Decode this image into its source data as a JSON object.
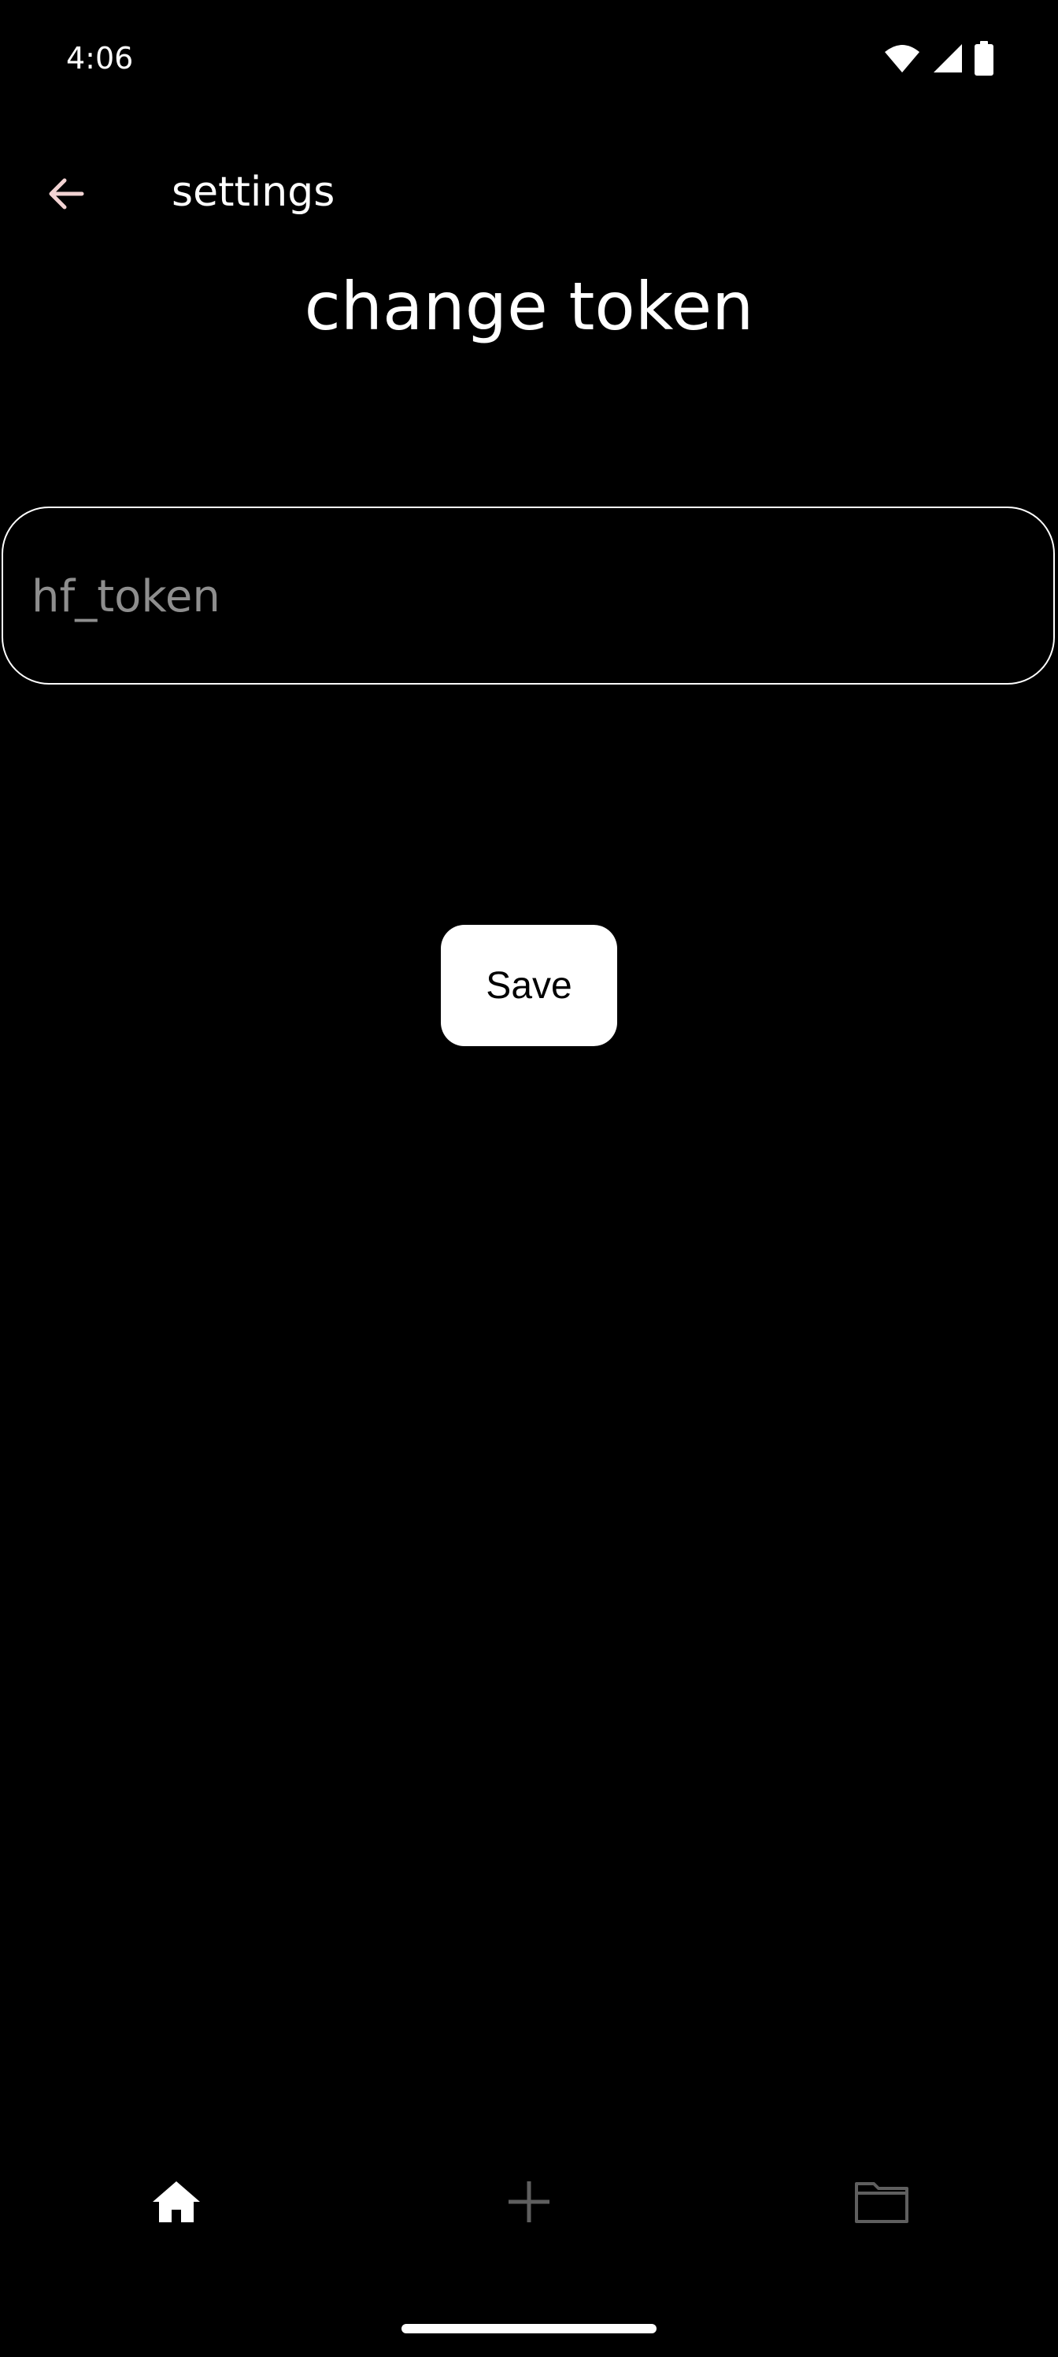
{
  "status_bar": {
    "time": "4:06",
    "icons": [
      "wifi-icon",
      "cellular-signal-icon",
      "battery-icon"
    ]
  },
  "app_bar": {
    "back_icon": "arrow-back-icon",
    "title": "settings"
  },
  "page": {
    "title": "change token"
  },
  "token_input": {
    "placeholder": "hf_token",
    "value": ""
  },
  "save_button": {
    "label": "Save"
  },
  "bottom_nav": {
    "items": [
      {
        "icon": "home-icon",
        "selected": true
      },
      {
        "icon": "add-icon",
        "selected": false
      },
      {
        "icon": "folder-icon",
        "selected": false
      }
    ]
  },
  "colors": {
    "background": "#000000",
    "foreground": "#ffffff",
    "placeholder": "#8e8e8e",
    "inactive_icon": "#5f5f5f",
    "back_arrow": "#f2d3d3"
  }
}
